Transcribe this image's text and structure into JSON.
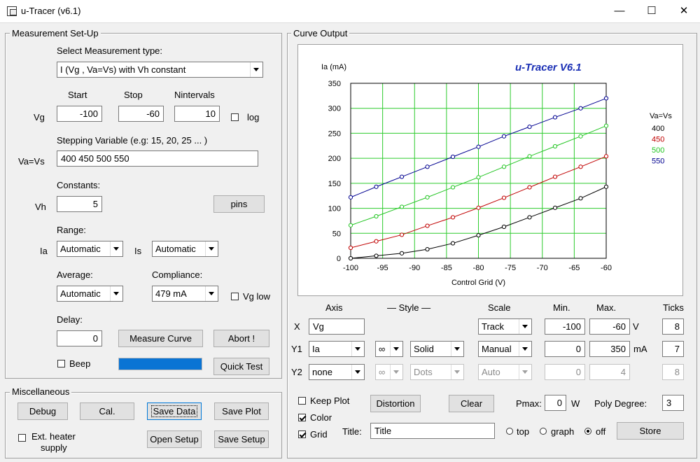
{
  "window": {
    "title": "u-Tracer (v6.1)",
    "minimize": "—",
    "maximize": "☐",
    "close": "✕"
  },
  "setup": {
    "group_title": "Measurement Set-Up",
    "select_type_label": "Select Measurement type:",
    "measurement_type": "I (Vg , Va=Vs) with Vh constant",
    "col_start": "Start",
    "col_stop": "Stop",
    "col_nintervals": "Nintervals",
    "vg_label": "Vg",
    "vg_start": "-100",
    "vg_stop": "-60",
    "vg_nintervals": "10",
    "log_label": "log",
    "stepping_label": "Stepping Variable (e.g: 15, 20, 25 ... )",
    "vavs_label": "Va=Vs",
    "vavs_value": "400 450 500 550",
    "constants_label": "Constants:",
    "vh_label": "Vh",
    "vh_value": "5",
    "pins_button": "pins",
    "range_label": "Range:",
    "ia_label": "Ia",
    "ia_range": "Automatic",
    "is_label": "Is",
    "is_range": "Automatic",
    "average_label": "Average:",
    "average_value": "Automatic",
    "compliance_label": "Compliance:",
    "compliance_value": "479 mA",
    "vglow_label": "Vg low",
    "delay_label": "Delay:",
    "delay_value": "0",
    "measure_button": "Measure Curve",
    "abort_button": "Abort !",
    "beep_label": "Beep",
    "progress": 1.0,
    "quicktest_button": "Quick Test"
  },
  "misc": {
    "group_title": "Miscellaneous",
    "debug_button": "Debug",
    "cal_button": "Cal.",
    "savedata_button": "Save Data",
    "saveplot_button": "Save Plot",
    "ext_heater_label_1": "Ext. heater",
    "ext_heater_label_2": "supply",
    "opensetup_button": "Open Setup",
    "savesetup_button": "Save Setup"
  },
  "curve": {
    "group_title": "Curve Output",
    "headers": {
      "axis": "Axis",
      "style": "— Style —",
      "scale": "Scale",
      "min": "Min.",
      "max": "Max.",
      "ticks": "Ticks"
    },
    "x": {
      "label": "X",
      "var": "Vg",
      "scale": "Track",
      "min": "-100",
      "max": "-60",
      "unit": "V",
      "ticks": "8"
    },
    "y1": {
      "label": "Y1",
      "var": "Ia",
      "style": "Solid",
      "scale": "Manual",
      "min": "0",
      "max": "350",
      "unit": "mA",
      "ticks": "7"
    },
    "y2": {
      "label": "Y2",
      "var": "none",
      "style": "Dots",
      "scale": "Auto",
      "min": "0",
      "max": "4",
      "ticks": "8"
    },
    "keepplot_label": "Keep Plot",
    "distortion_button": "Distortion",
    "clear_button": "Clear",
    "pmax_label": "Pmax:",
    "pmax_value": "0",
    "pmax_unit": "W",
    "poly_label": "Poly Degree:",
    "poly_value": "3",
    "color_label": "Color",
    "grid_label": "Grid",
    "title_label": "Title:",
    "title_value": "Title",
    "pos_top": "top",
    "pos_graph": "graph",
    "pos_off": "off",
    "store_button": "Store"
  },
  "chart_data": {
    "type": "line",
    "title": "u-Tracer V6.1",
    "xlabel": "Control Grid (V)",
    "ylabel": "Ia (mA)",
    "xlim": [
      -100,
      -60
    ],
    "ylim": [
      0,
      350
    ],
    "xticks": [
      -100,
      -95,
      -90,
      -85,
      -80,
      -75,
      -70,
      -65,
      -60
    ],
    "yticks": [
      0,
      50,
      100,
      150,
      200,
      250,
      300,
      350
    ],
    "grid": true,
    "legend_title": "Va=Vs",
    "legend_position": "right",
    "x": [
      -100,
      -96,
      -92,
      -88,
      -84,
      -80,
      -76,
      -72,
      -68,
      -64,
      -60
    ],
    "series": [
      {
        "name": "400",
        "color": "#000000",
        "values": [
          0,
          5,
          10,
          18,
          30,
          46,
          63,
          82,
          101,
          120,
          143
        ]
      },
      {
        "name": "450",
        "color": "#c00000",
        "values": [
          21,
          34,
          47,
          65,
          82,
          101,
          121,
          142,
          163,
          183,
          204
        ]
      },
      {
        "name": "500",
        "color": "#22c522",
        "values": [
          66,
          84,
          103,
          122,
          142,
          162,
          183,
          204,
          224,
          244,
          265
        ]
      },
      {
        "name": "550",
        "color": "#000090",
        "values": [
          122,
          143,
          163,
          183,
          203,
          223,
          244,
          263,
          282,
          300,
          320
        ]
      }
    ]
  }
}
